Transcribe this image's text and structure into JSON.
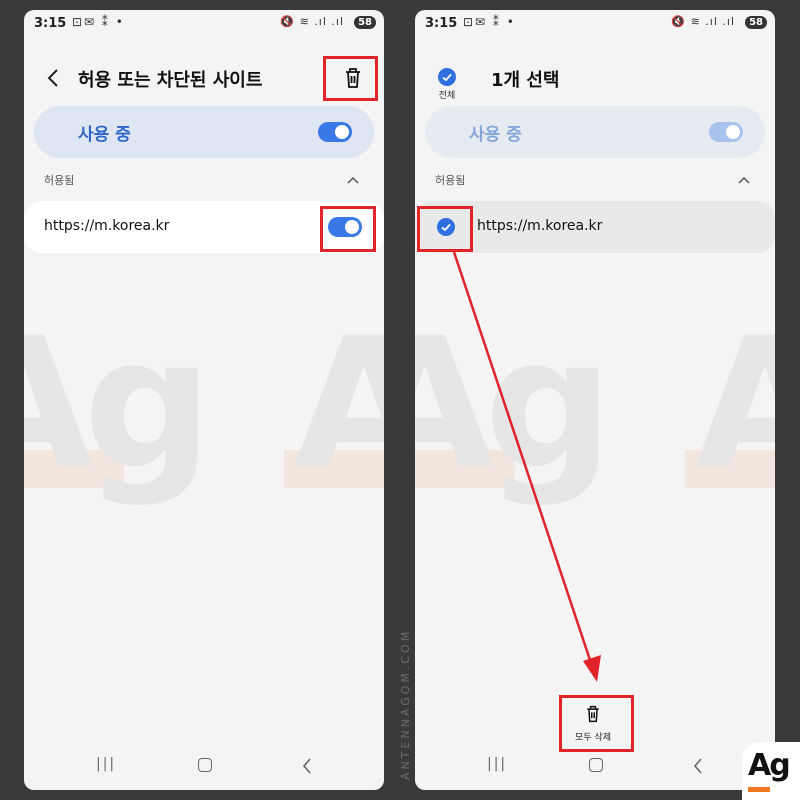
{
  "status_bar": {
    "time": "3:15",
    "left_icons": "⊡✉ ⁑ •",
    "right_icons": "🔇 ≋ .ıl .ıl",
    "battery": "58"
  },
  "left_screen": {
    "title": "허용 또는 차단된 사이트",
    "in_use_label": "사용 중",
    "in_use_enabled": true,
    "section_label": "허용됨",
    "site_url": "https://m.korea.kr",
    "site_enabled": true
  },
  "right_screen": {
    "select_all_label": "전체",
    "selection_title": "1개 선택",
    "in_use_label": "사용 중",
    "section_label": "허용됨",
    "site_url": "https://m.korea.kr",
    "site_selected": true,
    "delete_all_label": "모두 삭제"
  },
  "navbar": {
    "recent": "|||",
    "back": "<"
  },
  "vertical_text": "ANTENNAGOM.COM",
  "logo_text": "Ag",
  "watermark_text": "Ag",
  "colors": {
    "accent": "#3b78e7",
    "highlight": "#e0242a",
    "background": "#3a3a3a",
    "logo_bar": "#f07920"
  }
}
